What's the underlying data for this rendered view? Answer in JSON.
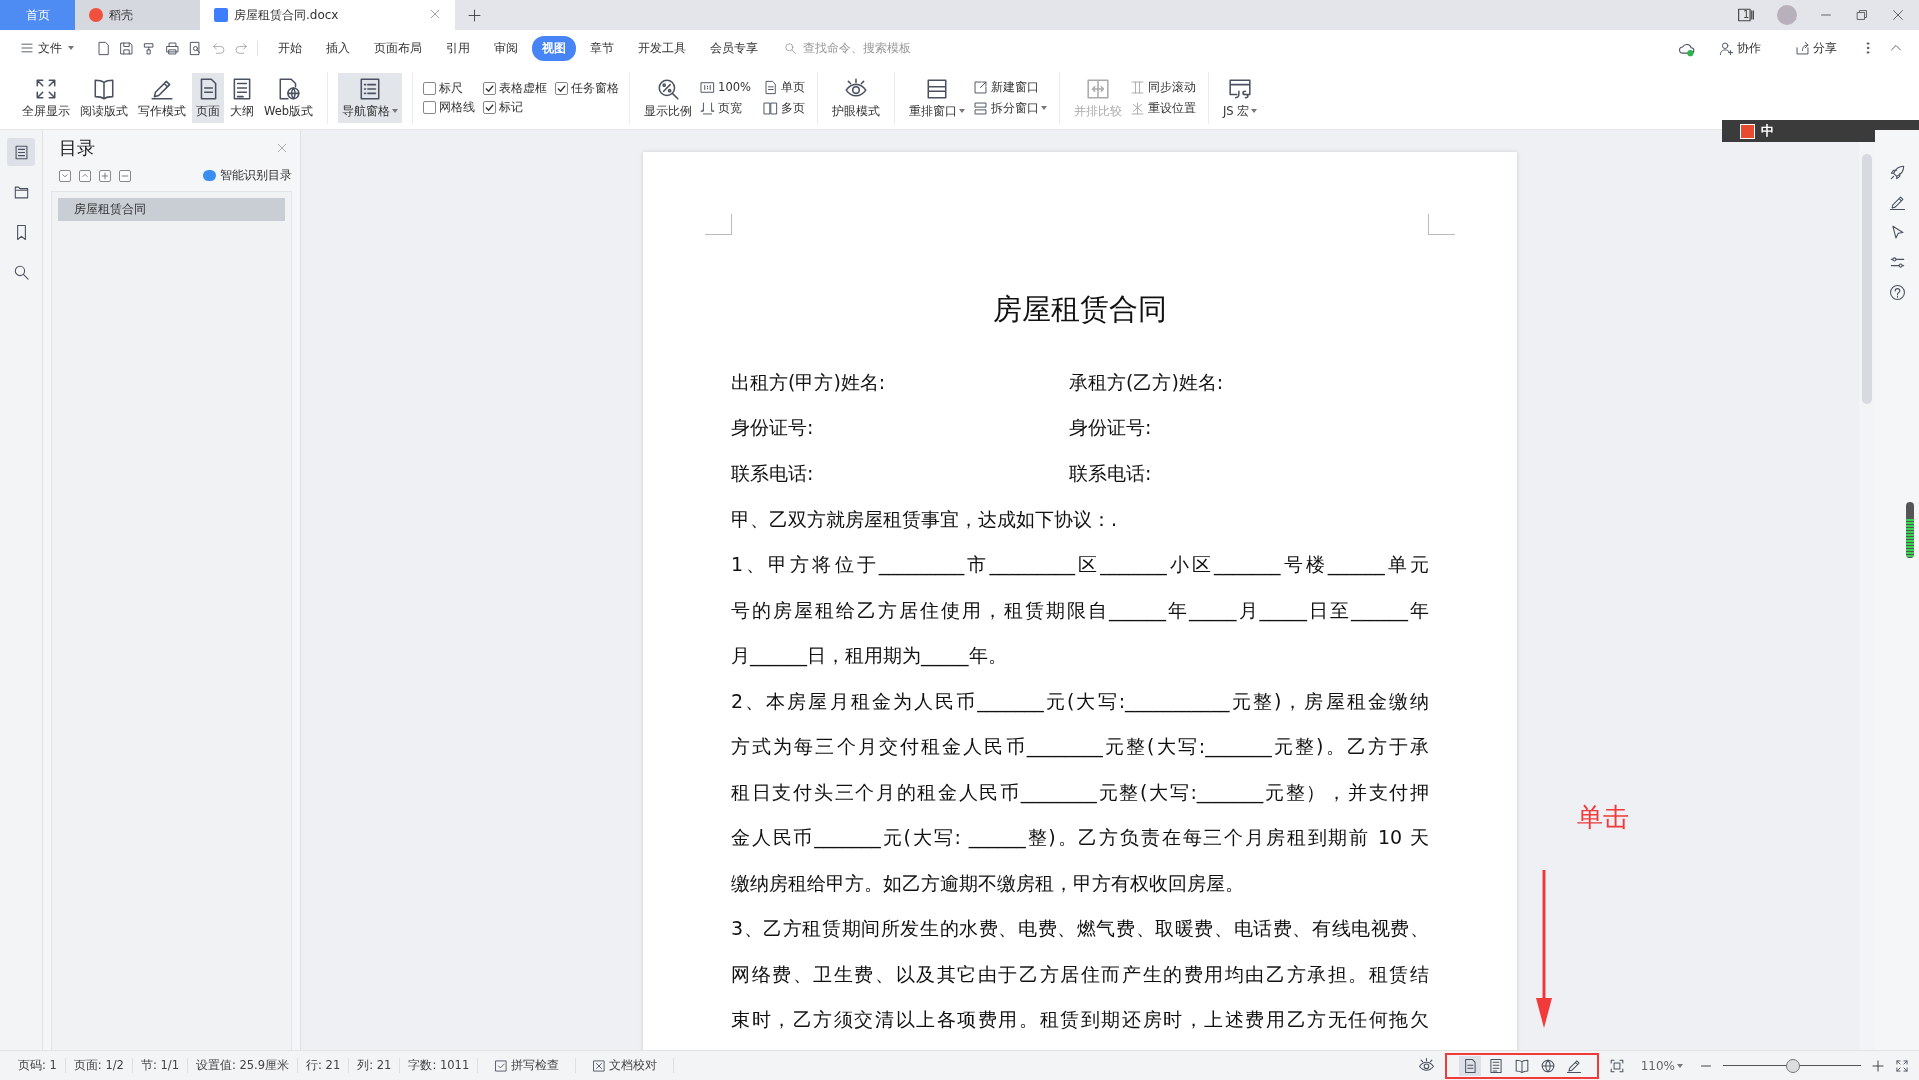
{
  "title_bar": {
    "tabs": [
      {
        "label": "首页",
        "kind": "home",
        "selected": false
      },
      {
        "label": "稻壳",
        "kind": "docer",
        "selected": false
      },
      {
        "label": "房屋租赁合同.docx",
        "kind": "doc",
        "selected": true
      }
    ],
    "window_count": "1"
  },
  "menu": {
    "file": "文件",
    "tabs": [
      {
        "label": "开始",
        "selected": false
      },
      {
        "label": "插入",
        "selected": false
      },
      {
        "label": "页面布局",
        "selected": false
      },
      {
        "label": "引用",
        "selected": false
      },
      {
        "label": "审阅",
        "selected": false
      },
      {
        "label": "视图",
        "selected": true
      },
      {
        "label": "章节",
        "selected": false
      },
      {
        "label": "开发工具",
        "selected": false
      },
      {
        "label": "会员专享",
        "selected": false
      }
    ],
    "search": {
      "placeholder": "查找命令、搜索模板"
    },
    "actions": [
      "协作",
      "分享"
    ]
  },
  "ribbon": {
    "groups": [
      {
        "items": [
          {
            "kind": "big",
            "label": "全屏显示",
            "selected": false,
            "dropdown": false,
            "disabled": false
          },
          {
            "kind": "big",
            "label": "阅读版式",
            "selected": false,
            "dropdown": false,
            "disabled": false
          },
          {
            "kind": "big",
            "label": "写作模式",
            "selected": false,
            "dropdown": false,
            "disabled": false
          },
          {
            "kind": "big",
            "label": "页面",
            "selected": true,
            "dropdown": false,
            "disabled": false
          },
          {
            "kind": "big",
            "label": "大纲",
            "selected": false,
            "dropdown": false,
            "disabled": false
          },
          {
            "kind": "big",
            "label": "Web版式",
            "selected": false,
            "dropdown": false,
            "disabled": false
          }
        ]
      },
      {
        "items": [
          {
            "kind": "big",
            "label": "导航窗格",
            "selected": true,
            "dropdown": true,
            "disabled": false
          }
        ]
      },
      {
        "items": [
          {
            "kind": "check",
            "label": "标尺",
            "checked": false
          },
          {
            "kind": "check",
            "label": "网格线",
            "checked": false
          },
          {
            "kind": "check",
            "label": "表格虚框",
            "checked": true
          },
          {
            "kind": "check",
            "label": "标记",
            "checked": true
          },
          {
            "kind": "check",
            "label": "任务窗格",
            "checked": true
          }
        ]
      },
      {
        "items": [
          {
            "kind": "big",
            "label": "显示比例",
            "selected": false,
            "dropdown": false,
            "disabled": false
          },
          {
            "kind": "small",
            "label": "100%",
            "dropdown": false,
            "disabled": false
          },
          {
            "kind": "small",
            "label": "页宽",
            "dropdown": false,
            "disabled": false
          },
          {
            "kind": "small",
            "label": "单页",
            "dropdown": false,
            "disabled": false
          },
          {
            "kind": "small",
            "label": "多页",
            "dropdown": false,
            "disabled": false
          }
        ]
      },
      {
        "items": [
          {
            "kind": "big",
            "label": "护眼模式",
            "selected": false,
            "dropdown": false,
            "disabled": false
          }
        ]
      },
      {
        "items": [
          {
            "kind": "big",
            "label": "重排窗口",
            "selected": false,
            "dropdown": true,
            "disabled": false
          },
          {
            "kind": "small",
            "label": "新建窗口",
            "dropdown": false,
            "disabled": false
          },
          {
            "kind": "small",
            "label": "拆分窗口",
            "dropdown": true,
            "disabled": false
          }
        ]
      },
      {
        "items": [
          {
            "kind": "big",
            "label": "并排比较",
            "selected": false,
            "dropdown": false,
            "disabled": true
          },
          {
            "kind": "small",
            "label": "同步滚动",
            "dropdown": false,
            "disabled": true
          },
          {
            "kind": "small",
            "label": "重设位置",
            "dropdown": false,
            "disabled": true
          }
        ]
      },
      {
        "items": [
          {
            "kind": "big",
            "label": "JS 宏",
            "selected": false,
            "dropdown": true,
            "disabled": false
          }
        ]
      }
    ]
  },
  "ime_bar": {
    "mode": "中"
  },
  "side_strip": [
    {
      "selected": true
    },
    {
      "selected": false
    },
    {
      "selected": false
    },
    {
      "selected": false
    }
  ],
  "nav_panel": {
    "title": "目录",
    "smart_toc": "智能识别目录",
    "items": [
      {
        "label": "房屋租赁合同",
        "selected": true
      }
    ]
  },
  "document": {
    "title": "房屋租赁合同",
    "lines": [
      {
        "kind": "pair",
        "left": "出租方(甲方)姓名:",
        "right": "承租方(乙方)姓名:"
      },
      {
        "kind": "pair",
        "left": "身份证号:",
        "right": "身份证号:"
      },
      {
        "kind": "pair",
        "left": "联系电话:",
        "right": "联系电话:"
      },
      {
        "kind": "text",
        "text": "甲、乙双方就房屋租赁事宜，达成如下协议：."
      },
      {
        "kind": "text",
        "text": "1、甲方将位于_________市_________区_______小区_______号楼______单元"
      },
      {
        "kind": "text",
        "text": "号的房屋租给乙方居住使用，租赁期限自______年_____月_____日至______年"
      },
      {
        "kind": "text",
        "text": "月______日，租用期为_____年。"
      },
      {
        "kind": "text",
        "text": "2、本房屋月租金为人民币_______元(大写:___________元整)，房屋租金缴纳"
      },
      {
        "kind": "text",
        "text": "方式为每三个月交付租金人民币________元整(大写:_______元整)。乙方于承"
      },
      {
        "kind": "text",
        "text": "租日支付头三个月的租金人民币________元整(大写:_______元整），并支付押"
      },
      {
        "kind": "text",
        "text": "金人民币_______元(大写: ______整)。乙方负责在每三个月房租到期前 10 天"
      },
      {
        "kind": "text",
        "text": "缴纳房租给甲方。如乙方逾期不缴房租，甲方有权收回房屋。"
      },
      {
        "kind": "text",
        "text": "3、乙方租赁期间所发生的水费、电费、燃气费、取暖费、电话费、有线电视费、"
      },
      {
        "kind": "text",
        "text": "网络费、卫生费、以及其它由于乙方居住而产生的费用均由乙方承担。租赁结"
      },
      {
        "kind": "text",
        "text": "束时，乙方须交清以上各项费用。租赁到期还房时，上述费用乙方无任何拖欠"
      }
    ]
  },
  "annotation": {
    "text": "单击"
  },
  "status_bar": {
    "items": [
      {
        "kind": "text",
        "label": "页码: 1"
      },
      {
        "kind": "text",
        "label": "页面: 1/2"
      },
      {
        "kind": "text",
        "label": "节: 1/1"
      },
      {
        "kind": "text",
        "label": "设置值: 25.9厘米"
      },
      {
        "kind": "text",
        "label": "行: 21"
      },
      {
        "kind": "text",
        "label": "列: 21"
      },
      {
        "kind": "text",
        "label": "字数: 1011"
      },
      {
        "kind": "tool",
        "label": "拼写检查"
      },
      {
        "kind": "tool",
        "label": "文档校对"
      }
    ],
    "views": [
      {
        "selected": true
      },
      {
        "selected": false
      },
      {
        "selected": false
      },
      {
        "selected": false
      },
      {
        "selected": false
      }
    ],
    "zoom": {
      "value": "110%",
      "level": 0.51
    }
  }
}
